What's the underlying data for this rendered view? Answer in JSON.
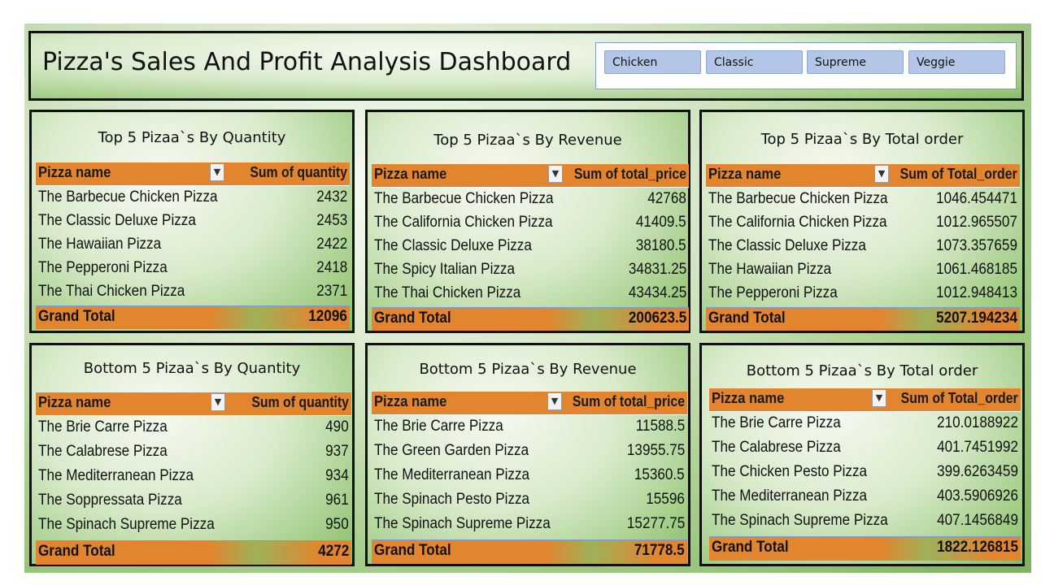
{
  "dashboard": {
    "title": "Pizza's Sales And Profit Analysis Dashboard",
    "slicer": [
      "Chicken",
      "Classic",
      "Supreme",
      "Veggie"
    ]
  },
  "panels": [
    {
      "title": "Top 5 Pizaa`s By Quantity",
      "col1": "Pizza name",
      "col2": "Sum of quantity",
      "rows": [
        {
          "name": "The Barbecue Chicken Pizza",
          "value": "2432"
        },
        {
          "name": "The Classic Deluxe Pizza",
          "value": "2453"
        },
        {
          "name": "The Hawaiian Pizza",
          "value": "2422"
        },
        {
          "name": "The Pepperoni Pizza",
          "value": "2418"
        },
        {
          "name": "The Thai Chicken Pizza",
          "value": "2371"
        }
      ],
      "total_label": "Grand Total",
      "total_value": "12096"
    },
    {
      "title": "Top 5 Pizaa`s By Revenue",
      "col1": "Pizza name",
      "col2": "Sum of total_price",
      "rows": [
        {
          "name": "The Barbecue Chicken Pizza",
          "value": "42768"
        },
        {
          "name": "The California Chicken Pizza",
          "value": "41409.5"
        },
        {
          "name": "The Classic Deluxe Pizza",
          "value": "38180.5"
        },
        {
          "name": "The Spicy Italian Pizza",
          "value": "34831.25"
        },
        {
          "name": "The Thai Chicken Pizza",
          "value": "43434.25"
        }
      ],
      "total_label": "Grand Total",
      "total_value": "200623.5"
    },
    {
      "title": "Top 5 Pizaa`s By Total order",
      "col1": "Pizza name",
      "col2": "Sum of Total_order",
      "rows": [
        {
          "name": "The Barbecue Chicken Pizza",
          "value": "1046.454471"
        },
        {
          "name": "The California Chicken Pizza",
          "value": "1012.965507"
        },
        {
          "name": "The Classic Deluxe Pizza",
          "value": "1073.357659"
        },
        {
          "name": "The Hawaiian Pizza",
          "value": "1061.468185"
        },
        {
          "name": "The Pepperoni Pizza",
          "value": "1012.948413"
        }
      ],
      "total_label": "Grand Total",
      "total_value": "5207.194234"
    },
    {
      "title": "Bottom 5 Pizaa`s By Quantity",
      "col1": "Pizza name",
      "col2": "Sum of quantity",
      "rows": [
        {
          "name": "The Brie Carre Pizza",
          "value": "490"
        },
        {
          "name": "The Calabrese Pizza",
          "value": "937"
        },
        {
          "name": "The Mediterranean Pizza",
          "value": "934"
        },
        {
          "name": "The Soppressata Pizza",
          "value": "961"
        },
        {
          "name": "The Spinach Supreme Pizza",
          "value": "950"
        }
      ],
      "total_label": "Grand Total",
      "total_value": "4272"
    },
    {
      "title": "Bottom 5 Pizaa`s By Revenue",
      "col1": "Pizza name",
      "col2": "Sum of total_price",
      "rows": [
        {
          "name": "The Brie Carre Pizza",
          "value": "11588.5"
        },
        {
          "name": "The Green Garden Pizza",
          "value": "13955.75"
        },
        {
          "name": "The Mediterranean Pizza",
          "value": "15360.5"
        },
        {
          "name": "The Spinach Pesto Pizza",
          "value": "15596"
        },
        {
          "name": "The Spinach Supreme Pizza",
          "value": "15277.75"
        }
      ],
      "total_label": "Grand Total",
      "total_value": "71778.5"
    },
    {
      "title": "Bottom 5 Pizaa`s By Total order",
      "col1": "Pizza name",
      "col2": "Sum of Total_order",
      "rows": [
        {
          "name": "The Brie Carre Pizza",
          "value": "210.0188922"
        },
        {
          "name": "The Calabrese Pizza",
          "value": "401.7451992"
        },
        {
          "name": "The Chicken Pesto Pizza",
          "value": "399.6263459"
        },
        {
          "name": "The Mediterranean Pizza",
          "value": "403.5906926"
        },
        {
          "name": "The Spinach Supreme Pizza",
          "value": "407.1456849"
        }
      ],
      "total_label": "Grand Total",
      "total_value": "1822.126815"
    }
  ]
}
